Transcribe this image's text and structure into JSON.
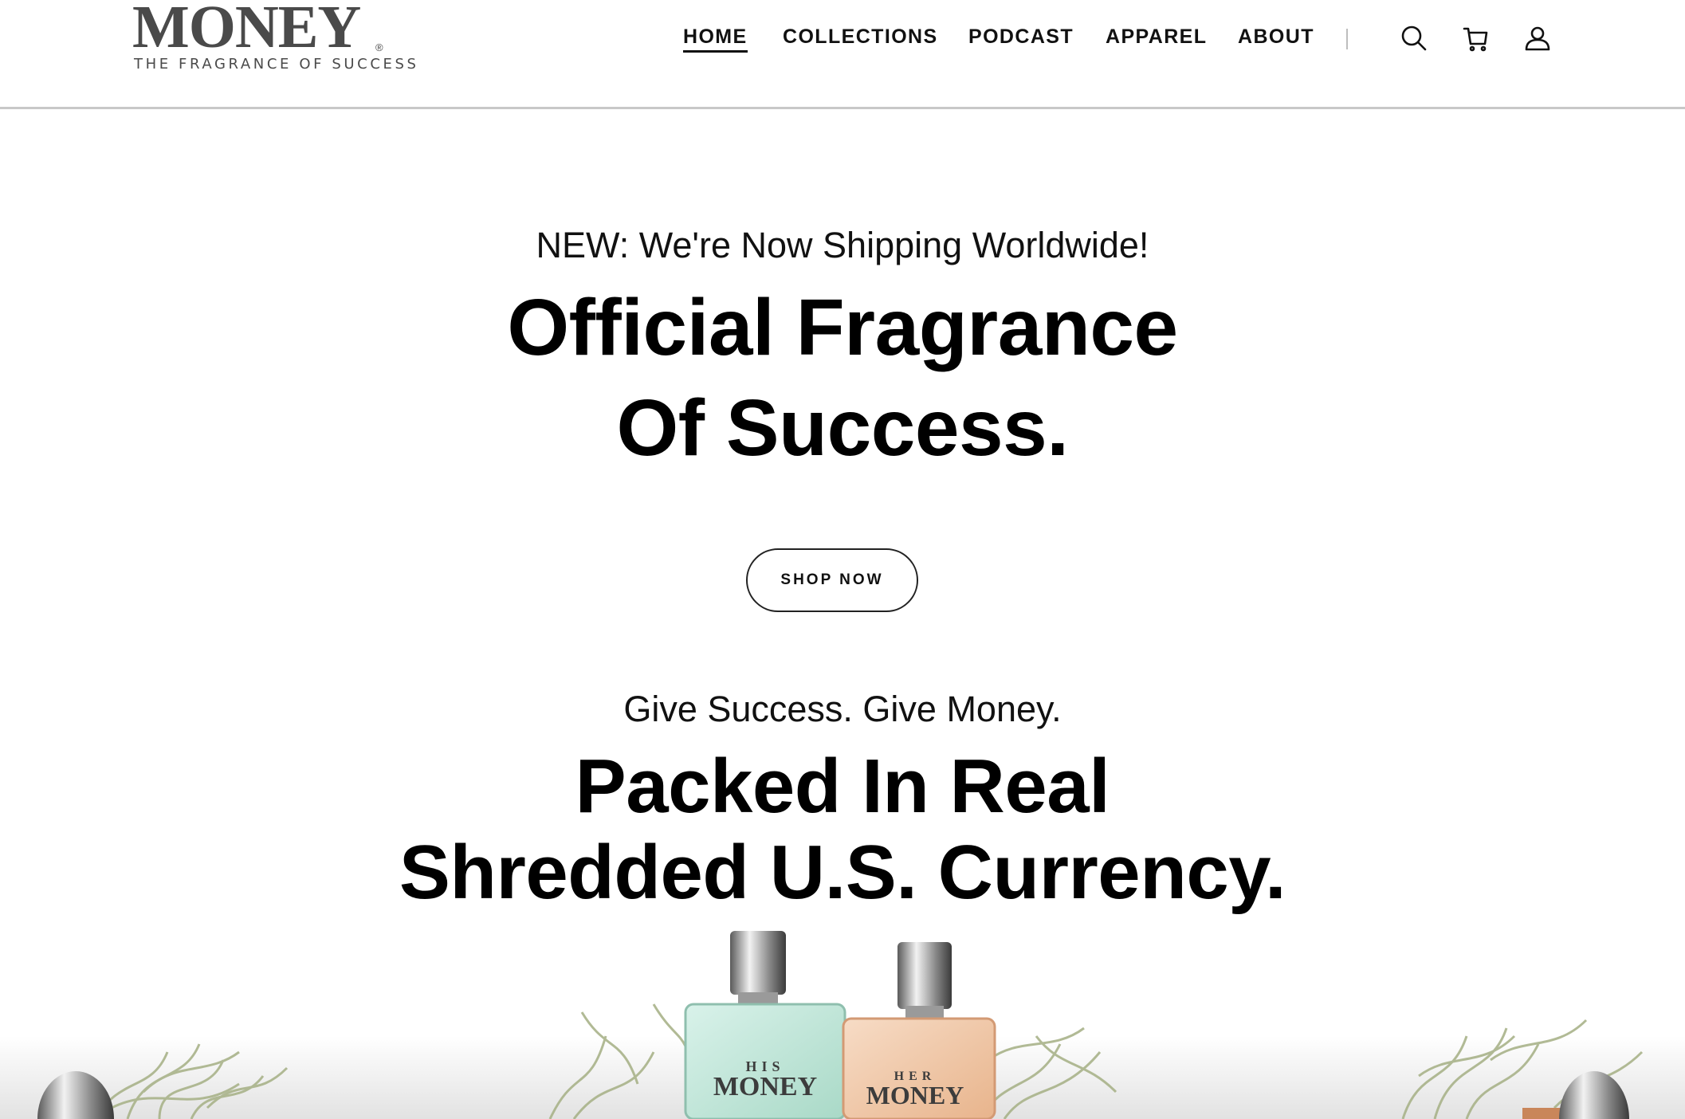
{
  "header": {
    "logo": {
      "wordmark": "MONEY",
      "registered": "®",
      "tagline": "THE FRAGRANCE OF SUCCESS"
    },
    "nav": [
      {
        "label": "HOME",
        "active": true
      },
      {
        "label": "COLLECTIONS",
        "active": false
      },
      {
        "label": "PODCAST",
        "active": false
      },
      {
        "label": "APPAREL",
        "active": false
      },
      {
        "label": "ABOUT",
        "active": false
      }
    ],
    "icons": [
      "search-icon",
      "cart-icon",
      "account-icon"
    ]
  },
  "hero": {
    "announcement": "NEW: We're Now Shipping Worldwide!",
    "headline_line1": "Official Fragrance",
    "headline_line2": "Of Success.",
    "cta_label": "SHOP NOW"
  },
  "gift": {
    "subhead": "Give Success. Give Money.",
    "headline_line1": "Packed In Real",
    "headline_line2": "Shredded U.S. Currency."
  },
  "products": {
    "his": {
      "small": "HIS",
      "name": "MONEY"
    },
    "her": {
      "small": "HER",
      "name": "MONEY"
    }
  },
  "colors": {
    "text": "#000000",
    "logo": "#4a4a4a",
    "header_border": "#c8c8c8",
    "his_bottle": "#bfe6d8",
    "her_bottle": "#f2c9a8",
    "shredded_money": "#a9b38a"
  }
}
